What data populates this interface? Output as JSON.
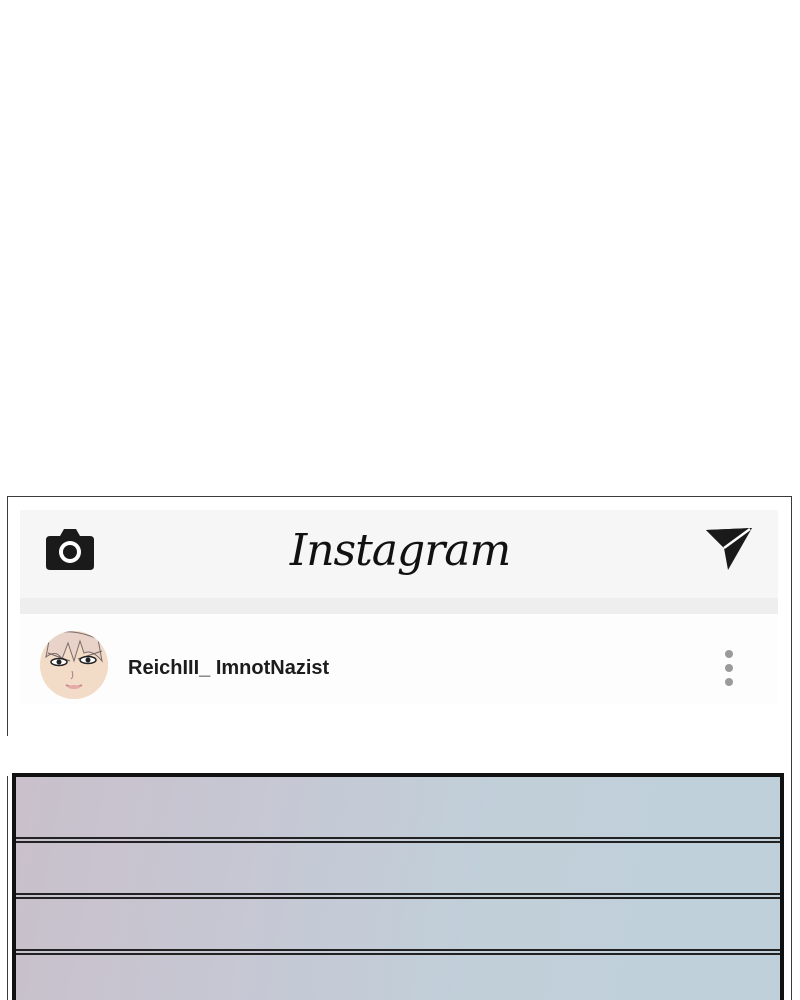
{
  "app": {
    "logo_text": "Instagram"
  },
  "top_bar": {
    "left_icon": "camera-icon",
    "right_icon": "send-icon"
  },
  "post": {
    "username": "ReichIII_ ImnotNazist",
    "avatar_icon": "avatar-face",
    "menu_icon": "more-vertical-icon"
  },
  "colors": {
    "top_bar_bg": "#f6f6f6",
    "icon": "#1a1a1a",
    "menu_dots": "#9a9a9a",
    "image_border": "#111111"
  }
}
